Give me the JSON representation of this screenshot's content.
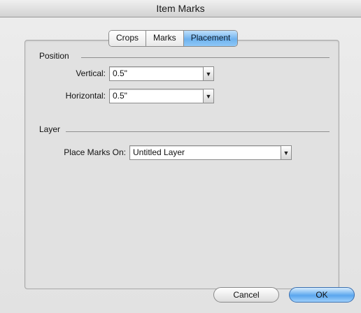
{
  "window": {
    "title": "Item Marks"
  },
  "tabs": [
    {
      "label": "Crops",
      "active": false
    },
    {
      "label": "Marks",
      "active": false
    },
    {
      "label": "Placement",
      "active": true
    }
  ],
  "position": {
    "heading": "Position",
    "vertical": {
      "label": "Vertical:",
      "value": "0.5\""
    },
    "horizontal": {
      "label": "Horizontal:",
      "value": "0.5\""
    }
  },
  "layer": {
    "heading": "Layer",
    "place_marks_on": {
      "label": "Place Marks On:",
      "value": "Untitled Layer"
    }
  },
  "buttons": {
    "cancel": "Cancel",
    "ok": "OK"
  },
  "icons": {
    "dropdown": "▼"
  },
  "colors": {
    "accent": "#6fb2ee",
    "ok_button": "#5aa6ee"
  }
}
